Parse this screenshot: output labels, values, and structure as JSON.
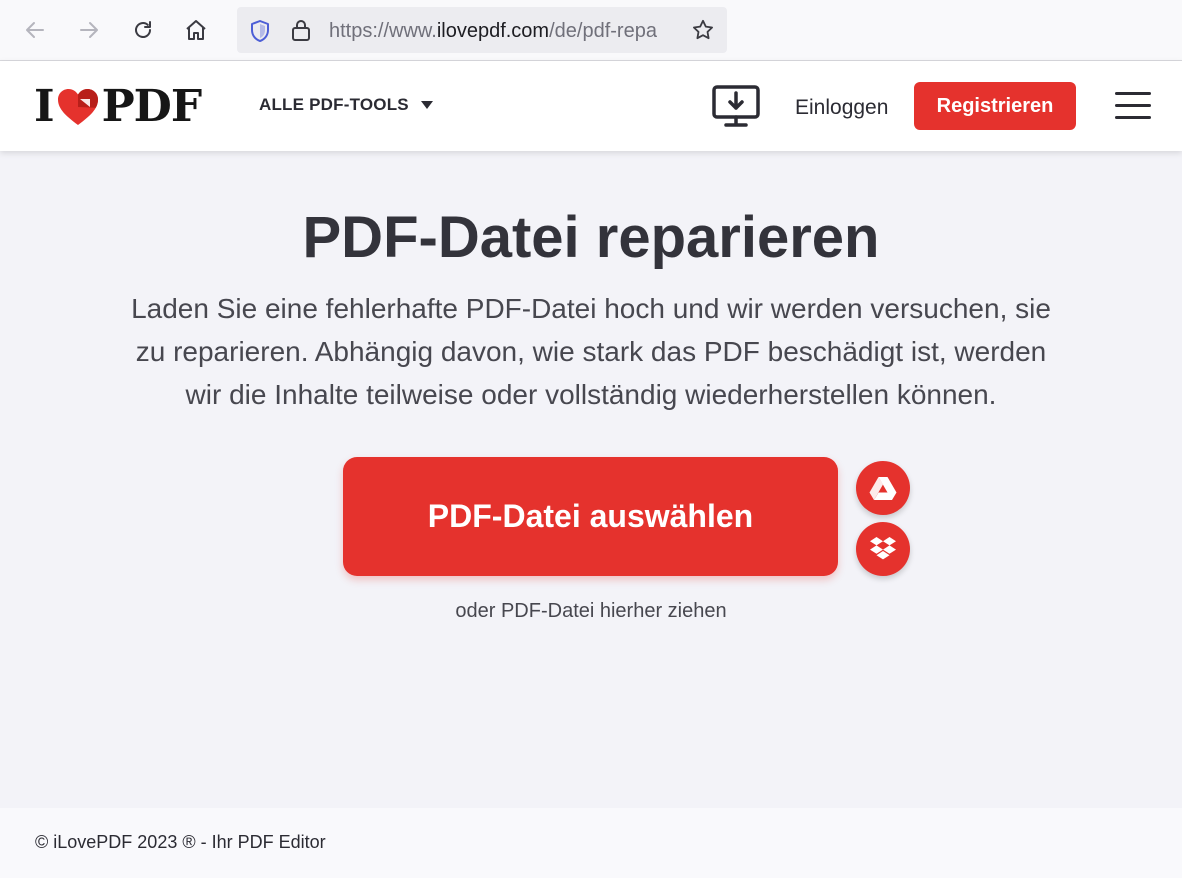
{
  "browser": {
    "url_prefix": "https://www.",
    "url_host": "ilovepdf.com",
    "url_path": "/de/pdf-repa",
    "icons": [
      "back-arrow-icon",
      "forward-arrow-icon",
      "reload-icon",
      "home-icon",
      "shield-icon",
      "lock-icon",
      "star-icon"
    ]
  },
  "header": {
    "logo_left": "I",
    "logo_right": "PDF",
    "tools_label": "ALLE PDF-TOOLS",
    "login_label": "Einloggen",
    "register_label": "Registrieren"
  },
  "main": {
    "title": "PDF-Datei reparieren",
    "description_lines": [
      "Laden Sie eine fehlerhafte PDF-Datei hoch und wir werden versuchen, sie",
      "zu reparieren. Abhängig davon, wie stark das PDF beschädigt ist, werden",
      "wir die Inhalte teilweise oder vollständig wiederherstellen können."
    ],
    "select_button": "PDF-Datei auswählen",
    "drop_hint": "oder PDF-Datei hierher ziehen"
  },
  "footer": {
    "copyright": "© iLovePDF 2023 ® - Ihr PDF Editor"
  },
  "colors": {
    "brand_red": "#e5322d",
    "text_dark": "#33333b",
    "page_bg": "#f3f3f8"
  }
}
